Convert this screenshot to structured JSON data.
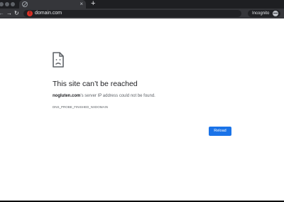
{
  "browser": {
    "tab": {
      "title": "",
      "close_glyph": "×"
    },
    "new_tab_glyph": "+",
    "toolbar": {
      "back_glyph": "←",
      "forward_glyph": "→",
      "reload_glyph": "↻",
      "url": "domain.com",
      "incognito_label": "Incognito"
    }
  },
  "error_page": {
    "icon": "sad-page-icon",
    "title": "This site can’t be reached",
    "message_host": "nogluten.com",
    "message_rest": "’s server IP address could not be found.",
    "error_code": "DNS_PROBE_FINISHED_NXDOMAIN",
    "reload_label": "Reload"
  },
  "colors": {
    "tab_strip": "#1e1f22",
    "toolbar": "#35363a",
    "omnibox": "#202124",
    "page_bg": "#ffffff",
    "title_text": "#202124",
    "secondary_text": "#5f6368",
    "reload_button": "#1a73e8",
    "warning_icon": "#d93025"
  }
}
